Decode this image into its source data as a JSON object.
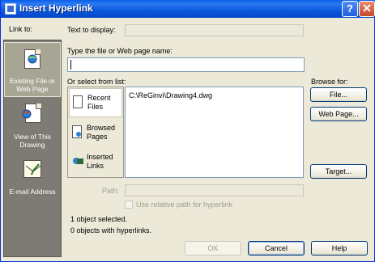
{
  "window": {
    "title": "Insert Hyperlink"
  },
  "titlebar_buttons": {
    "help": "?",
    "close": "✕"
  },
  "link_to": {
    "heading": "Link to:",
    "items": [
      {
        "label": "Existing File or Web Page",
        "selected": true
      },
      {
        "label": "View of This Drawing",
        "selected": false
      },
      {
        "label": "E-mail Address",
        "selected": false
      }
    ]
  },
  "text_to_display": {
    "label": "Text to display:",
    "value": ""
  },
  "file_name": {
    "label": "Type the file or Web page name:",
    "value": ""
  },
  "select_from_list": {
    "label": "Or select from list:",
    "places": [
      {
        "label": "Recent Files"
      },
      {
        "label": "Browsed Pages"
      },
      {
        "label": "Inserted Links"
      }
    ],
    "files": [
      "C:\\ReGinvi\\Drawing4.dwg"
    ]
  },
  "browse_for": {
    "label": "Browse for:",
    "file_button": "File...",
    "web_page_button": "Web Page...",
    "target_button": "Target..."
  },
  "path": {
    "label": "Path:",
    "value": ""
  },
  "relative_path": {
    "label": "Use relative path for hyperlink",
    "checked": false
  },
  "status": {
    "objects_selected": "1 object selected.",
    "objects_with_hyperlinks": "0 objects with hyperlinks."
  },
  "footer": {
    "ok": "OK",
    "cancel": "Cancel",
    "help": "Help"
  }
}
